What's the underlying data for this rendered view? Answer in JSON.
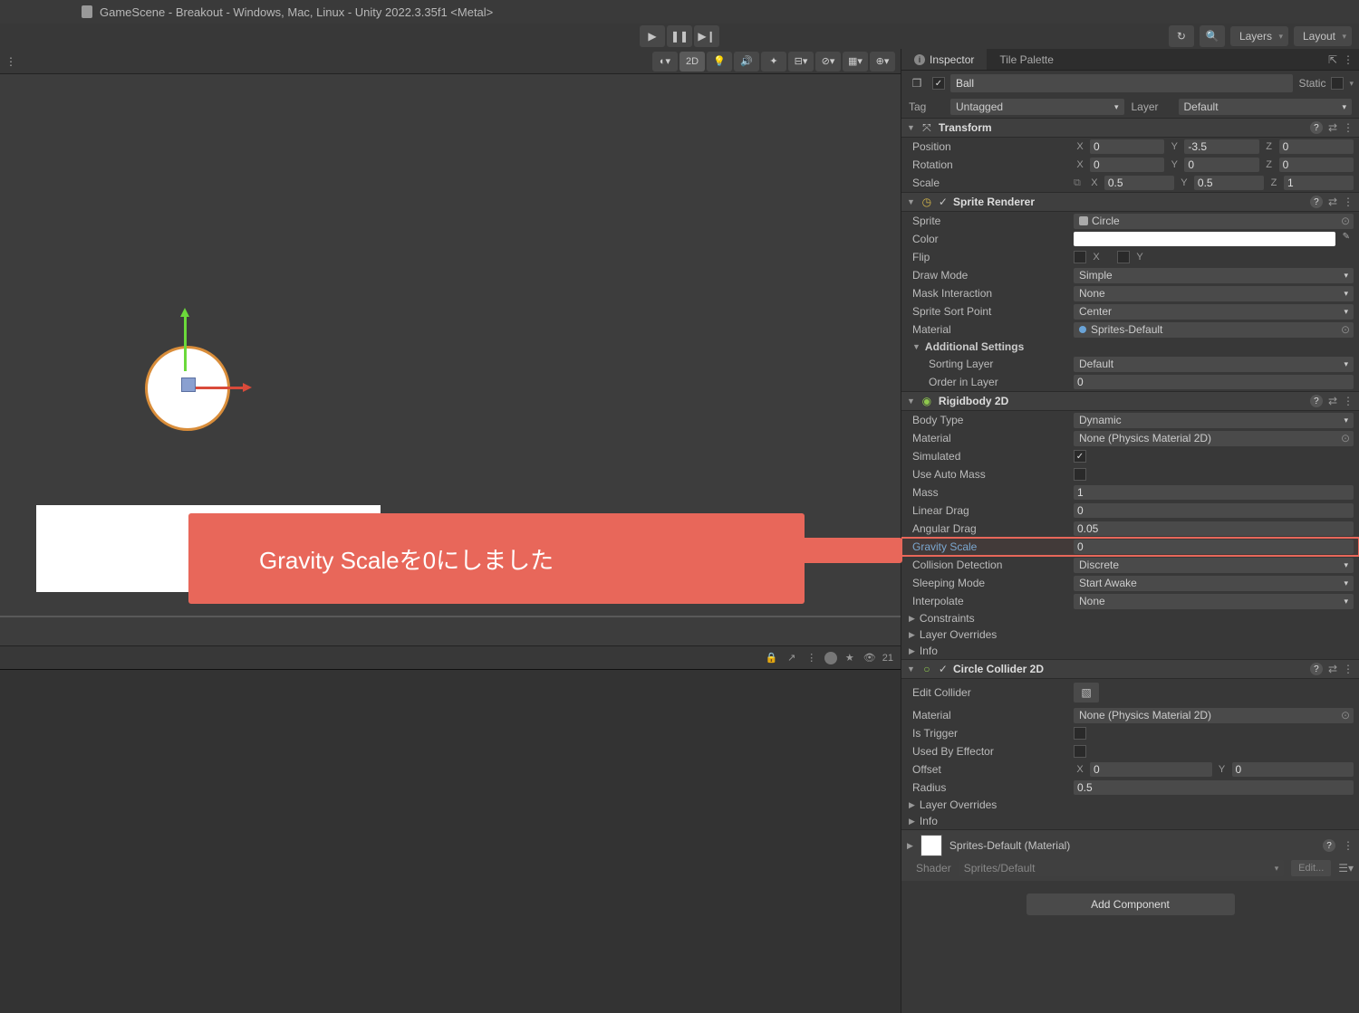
{
  "window_title": "GameScene - Breakout - Windows, Mac, Linux - Unity 2022.3.35f1 <Metal>",
  "top_right": {
    "layers": "Layers",
    "layout": "Layout"
  },
  "scene_toolbar": {
    "mode_2d": "2D"
  },
  "scene_meta": {
    "eye_count": "21"
  },
  "callout": "Gravity Scaleを0にしました",
  "tabs": {
    "inspector": "Inspector",
    "tile_palette": "Tile Palette"
  },
  "object": {
    "name": "Ball",
    "static_label": "Static"
  },
  "tag_layer": {
    "tag_lbl": "Tag",
    "tag_val": "Untagged",
    "layer_lbl": "Layer",
    "layer_val": "Default"
  },
  "transform": {
    "title": "Transform",
    "position": {
      "lbl": "Position",
      "x": "0",
      "y": "-3.5",
      "z": "0"
    },
    "rotation": {
      "lbl": "Rotation",
      "x": "0",
      "y": "0",
      "z": "0"
    },
    "scale": {
      "lbl": "Scale",
      "x": "0.5",
      "y": "0.5",
      "z": "1"
    }
  },
  "sprite_renderer": {
    "title": "Sprite Renderer",
    "sprite": {
      "lbl": "Sprite",
      "val": "Circle"
    },
    "color": {
      "lbl": "Color"
    },
    "flip": {
      "lbl": "Flip",
      "x": "X",
      "y": "Y"
    },
    "draw_mode": {
      "lbl": "Draw Mode",
      "val": "Simple"
    },
    "mask_interaction": {
      "lbl": "Mask Interaction",
      "val": "None"
    },
    "sort_point": {
      "lbl": "Sprite Sort Point",
      "val": "Center"
    },
    "material": {
      "lbl": "Material",
      "val": "Sprites-Default"
    },
    "additional": "Additional Settings",
    "sorting_layer": {
      "lbl": "Sorting Layer",
      "val": "Default"
    },
    "order_in_layer": {
      "lbl": "Order in Layer",
      "val": "0"
    }
  },
  "rigidbody": {
    "title": "Rigidbody 2D",
    "body_type": {
      "lbl": "Body Type",
      "val": "Dynamic"
    },
    "material": {
      "lbl": "Material",
      "val": "None (Physics Material 2D)"
    },
    "simulated": {
      "lbl": "Simulated"
    },
    "use_auto_mass": {
      "lbl": "Use Auto Mass"
    },
    "mass": {
      "lbl": "Mass",
      "val": "1"
    },
    "linear_drag": {
      "lbl": "Linear Drag",
      "val": "0"
    },
    "angular_drag": {
      "lbl": "Angular Drag",
      "val": "0.05"
    },
    "gravity_scale": {
      "lbl": "Gravity Scale",
      "val": "0"
    },
    "collision_detection": {
      "lbl": "Collision Detection",
      "val": "Discrete"
    },
    "sleeping_mode": {
      "lbl": "Sleeping Mode",
      "val": "Start Awake"
    },
    "interpolate": {
      "lbl": "Interpolate",
      "val": "None"
    },
    "constraints": "Constraints",
    "layer_overrides": "Layer Overrides",
    "info": "Info"
  },
  "circle_collider": {
    "title": "Circle Collider 2D",
    "edit_collider": {
      "lbl": "Edit Collider"
    },
    "material": {
      "lbl": "Material",
      "val": "None (Physics Material 2D)"
    },
    "is_trigger": {
      "lbl": "Is Trigger"
    },
    "used_by_effector": {
      "lbl": "Used By Effector"
    },
    "offset": {
      "lbl": "Offset",
      "x": "0",
      "y": "0"
    },
    "radius": {
      "lbl": "Radius",
      "val": "0.5"
    },
    "layer_overrides": "Layer Overrides",
    "info": "Info"
  },
  "material_preview": {
    "title": "Sprites-Default (Material)",
    "shader_lbl": "Shader",
    "shader_val": "Sprites/Default",
    "edit": "Edit..."
  },
  "add_component": "Add Component"
}
